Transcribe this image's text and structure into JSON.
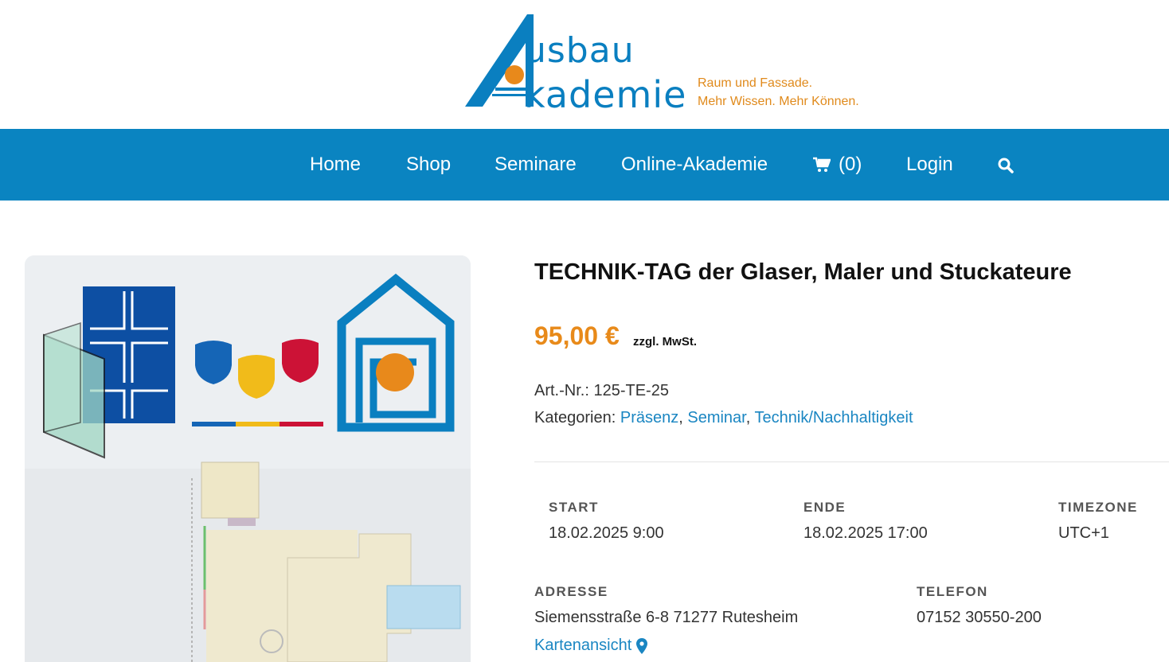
{
  "logo": {
    "word1": "usbau",
    "word2": "kademie",
    "tagline1": "Raum und Fassade.",
    "tagline2": "Mehr Wissen. Mehr Können."
  },
  "nav": {
    "items": [
      {
        "label": "Home"
      },
      {
        "label": "Shop"
      },
      {
        "label": "Seminare"
      },
      {
        "label": "Online-Akademie"
      },
      {
        "label": "(0)"
      },
      {
        "label": "Login"
      }
    ],
    "cart_icon": "cart-icon",
    "search_icon": "search-icon"
  },
  "product": {
    "title": "TECHNIK-TAG der Glaser, Maler und Stuckateure",
    "price": "95,00 €",
    "tax_note": "zzgl. MwSt.",
    "sku_label": "Art.-Nr.:",
    "sku": "125-TE-25",
    "categories_label": "Kategorien:",
    "categories": [
      "Präsenz",
      "Seminar",
      "Technik/Nachhaltigkeit"
    ]
  },
  "event": {
    "start_label": "START",
    "start_value": "18.02.2025 9:00",
    "end_label": "ENDE",
    "end_value": "18.02.2025 17:00",
    "timezone_label": "TIMEZONE",
    "timezone_value": "UTC+1",
    "address_label": "ADRESSE",
    "address_value": "Siemensstraße 6-8 71277 Rutesheim",
    "phone_label": "TELEFON",
    "phone_value": "07152 30550-200",
    "map_link": "Kartenansicht"
  },
  "colors": {
    "brand_blue": "#0a84c1",
    "accent_orange": "#e88a1a",
    "link_blue": "#1a86c2"
  }
}
